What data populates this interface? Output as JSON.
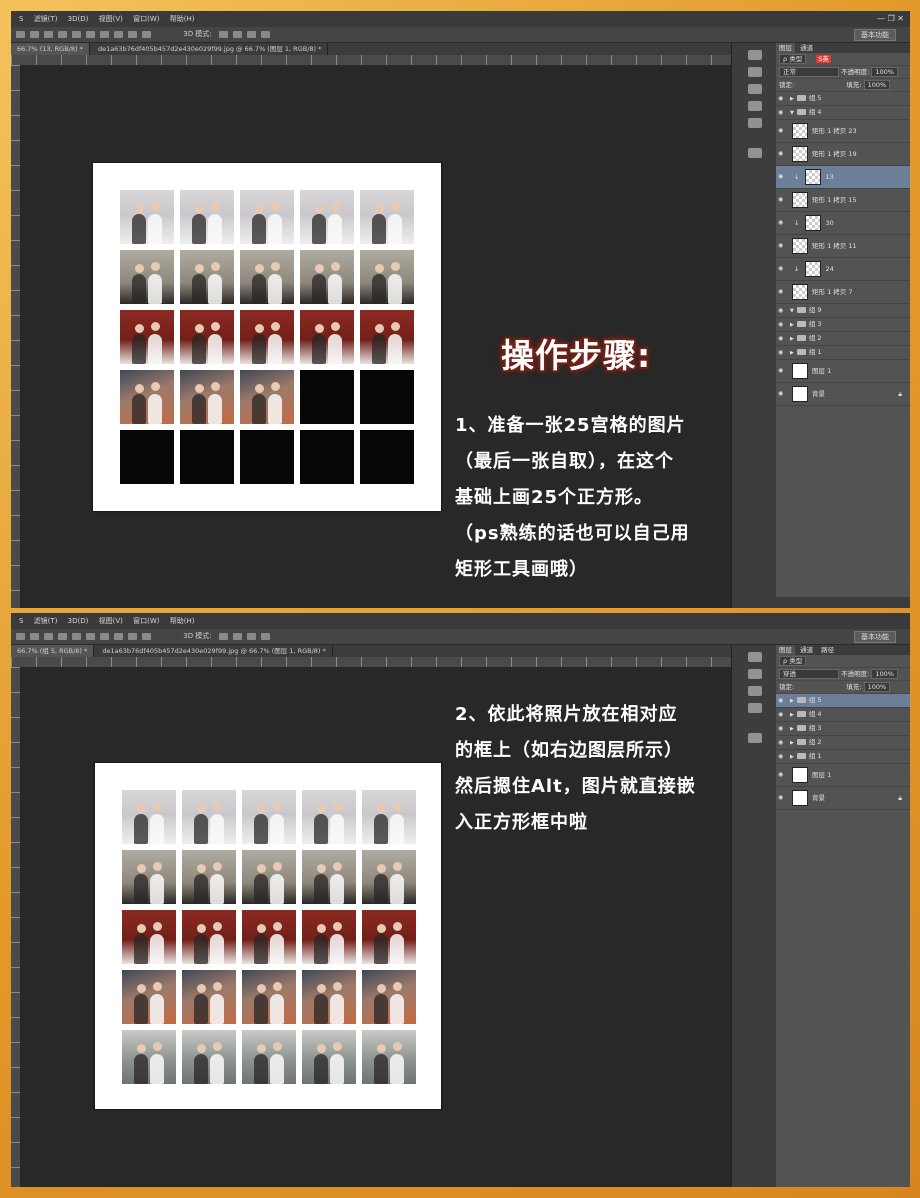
{
  "menu": [
    "S",
    "滤镜(T)",
    "3D(D)",
    "视图(V)",
    "窗口(W)",
    "帮助(H)"
  ],
  "mode3d": "3D 模式:",
  "preset": "基本功能",
  "doc_tabs": [
    "66.7% (13, RGB/8) *",
    "de1a63b76df405b457d2e430e029f99.jpg @ 66.7% (图层 1, RGB/8) *"
  ],
  "doc_tabs_2": [
    "66.7% (组 5, RGB/8) *",
    "de1a63b76df405b457d2e430e029f99.jpg @ 66.7% (图层 1, RGB/8) *"
  ],
  "ruler_labels": [
    "6",
    "4",
    "2",
    "0",
    "2",
    "4",
    "6",
    "8",
    "10",
    "12",
    "14",
    "16",
    "18",
    "20",
    "22",
    "24",
    "26",
    "28",
    "30",
    "32",
    "34",
    "36",
    "38",
    "40",
    "42",
    "44",
    "46",
    "48",
    "50",
    "52",
    "54",
    "56"
  ],
  "panel": {
    "tabs": [
      "图层",
      "通道",
      "路径"
    ],
    "kind": "ρ 类型",
    "ime": "S英",
    "blend_1": "正常",
    "blend_2": "穿透",
    "opacity_label": "不透明度:",
    "opacity": "100%",
    "lock_label": "锁定:",
    "fill_label": "填充:",
    "fill": "100%"
  },
  "layers_1": [
    {
      "name": "组 5",
      "type": "group"
    },
    {
      "name": "组 4",
      "type": "group-open"
    },
    {
      "name": "矩形 1 拷贝 23",
      "type": "shape"
    },
    {
      "name": "矩形 1 拷贝 19",
      "type": "shape"
    },
    {
      "name": "13",
      "type": "clip",
      "selected": true
    },
    {
      "name": "矩形 1 拷贝 15",
      "type": "shape"
    },
    {
      "name": "30",
      "type": "clip"
    },
    {
      "name": "矩形 1 拷贝 11",
      "type": "shape"
    },
    {
      "name": "24",
      "type": "clip"
    },
    {
      "name": "矩形 1 拷贝 7",
      "type": "shape"
    },
    {
      "name": "组 9",
      "type": "group-open"
    },
    {
      "name": "组 3",
      "type": "group"
    },
    {
      "name": "组 2",
      "type": "group"
    },
    {
      "name": "组 1",
      "type": "group"
    },
    {
      "name": "图层 1",
      "type": "pixel"
    },
    {
      "name": "背景",
      "type": "bg"
    }
  ],
  "layers_2": [
    {
      "name": "组 5",
      "type": "group",
      "selected": true
    },
    {
      "name": "组 4",
      "type": "group"
    },
    {
      "name": "组 3",
      "type": "group"
    },
    {
      "name": "组 2",
      "type": "group"
    },
    {
      "name": "组 1",
      "type": "group"
    },
    {
      "name": "图层 1",
      "type": "pixel"
    },
    {
      "name": "背景",
      "type": "bg"
    }
  ],
  "heading": "操作步骤:",
  "step1": "1、准备一张25宫格的图片\n（最后一张自取），在这个\n基础上画25个正方形。\n（ps熟练的话也可以自己用\n矩形工具画哦）",
  "step2": "2、依此将照片放在相对应\n的框上（如右边图层所示）\n然后摁住Alt，图片就直接嵌\n入正方形框中啦",
  "grid1": [
    "a",
    "a",
    "a",
    "a",
    "a",
    "b",
    "b",
    "b",
    "b",
    "b",
    "c",
    "c",
    "c",
    "c",
    "c",
    "d",
    "d",
    "d",
    "empty",
    "empty",
    "empty",
    "empty",
    "empty",
    "empty",
    "empty"
  ],
  "grid2": [
    "a",
    "a",
    "a",
    "a",
    "a",
    "b",
    "b",
    "b",
    "b",
    "b",
    "c",
    "c",
    "c",
    "c",
    "c",
    "d",
    "d",
    "d",
    "d",
    "d",
    "e",
    "e",
    "e",
    "e",
    "e"
  ]
}
